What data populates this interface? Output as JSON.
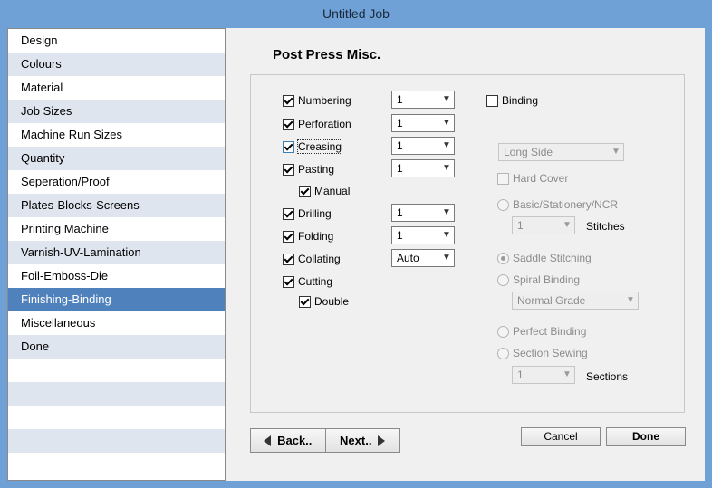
{
  "window": {
    "title": "Untitled Job"
  },
  "sidebar": {
    "items": [
      {
        "label": "Design"
      },
      {
        "label": "Colours"
      },
      {
        "label": "Material"
      },
      {
        "label": "Job Sizes"
      },
      {
        "label": "Machine Run Sizes"
      },
      {
        "label": "Quantity"
      },
      {
        "label": "Seperation/Proof"
      },
      {
        "label": "Plates-Blocks-Screens"
      },
      {
        "label": "Printing Machine"
      },
      {
        "label": "Varnish-UV-Lamination"
      },
      {
        "label": "Foil-Emboss-Die"
      },
      {
        "label": "Finishing-Binding"
      },
      {
        "label": "Miscellaneous"
      },
      {
        "label": "Done"
      }
    ],
    "selected": "Finishing-Binding"
  },
  "page": {
    "title": "Post Press Misc."
  },
  "options": {
    "numbering": {
      "label": "Numbering",
      "checked": true,
      "value": "1"
    },
    "perforation": {
      "label": "Perforation",
      "checked": true,
      "value": "1"
    },
    "creasing": {
      "label": "Creasing",
      "checked": true,
      "value": "1"
    },
    "pasting": {
      "label": "Pasting",
      "checked": true,
      "value": "1"
    },
    "manual": {
      "label": "Manual",
      "checked": true
    },
    "drilling": {
      "label": "Drilling",
      "checked": true,
      "value": "1"
    },
    "folding": {
      "label": "Folding",
      "checked": true,
      "value": "1"
    },
    "collating": {
      "label": "Collating",
      "checked": true,
      "value": "Auto"
    },
    "cutting": {
      "label": "Cutting",
      "checked": true
    },
    "double": {
      "label": "Double",
      "checked": true
    }
  },
  "binding": {
    "label": "Binding",
    "checked": false,
    "side_value": "Long Side",
    "hard_cover_label": "Hard Cover",
    "basic_label": "Basic/Stationery/NCR",
    "stitches_value": "1",
    "stitches_label": "Stitches",
    "saddle_label": "Saddle Stitching",
    "spiral_label": "Spiral Binding",
    "grade_value": "Normal Grade",
    "perfect_label": "Perfect Binding",
    "section_label": "Section Sewing",
    "sections_value": "1",
    "sections_label": "Sections"
  },
  "buttons": {
    "back": "Back..",
    "next": "Next..",
    "cancel": "Cancel",
    "done": "Done"
  }
}
